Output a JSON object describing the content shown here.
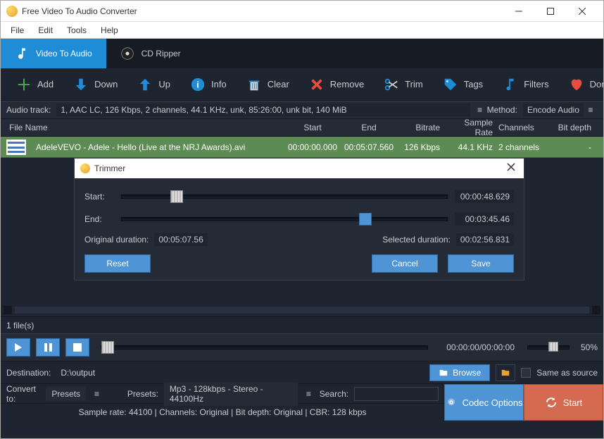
{
  "window": {
    "title": "Free Video To Audio Converter"
  },
  "menu": {
    "file": "File",
    "edit": "Edit",
    "tools": "Tools",
    "help": "Help"
  },
  "tabs": {
    "video_to_audio": "Video To Audio",
    "cd_ripper": "CD Ripper"
  },
  "toolbar": {
    "add": "Add",
    "down": "Down",
    "up": "Up",
    "info": "Info",
    "clear": "Clear",
    "remove": "Remove",
    "trim": "Trim",
    "tags": "Tags",
    "filters": "Filters",
    "donate": "Donate"
  },
  "audio_track": {
    "label": "Audio track:",
    "value": "1, AAC LC, 126 Kbps, 2 channels, 44.1 KHz, unk, 85:26:00, unk bit, 140 MiB",
    "method_label": "Method:",
    "method_value": "Encode Audio"
  },
  "columns": {
    "file_name": "File Name",
    "start": "Start",
    "end": "End",
    "bitrate": "Bitrate",
    "sample_rate": "Sample Rate",
    "channels": "Channels",
    "bit_depth": "Bit depth"
  },
  "file_row": {
    "name": "AdeleVEVO - Adele - Hello (Live at the NRJ Awards).avi",
    "start": "00:00:00.000",
    "end": "00:05:07.560",
    "bitrate": "126 Kbps",
    "sample_rate": "44.1 KHz",
    "channels": "2 channels",
    "bit_depth": "-"
  },
  "trimmer": {
    "title": "Trimmer",
    "start_label": "Start:",
    "start_value": "00:00:48.629",
    "end_label": "End:",
    "end_value": "00:03:45.46",
    "orig_label": "Original duration:",
    "orig_value": "00:05:07.56",
    "sel_label": "Selected duration:",
    "sel_value": "00:02:56.831",
    "reset": "Reset",
    "cancel": "Cancel",
    "save": "Save"
  },
  "file_count": "1 file(s)",
  "playbar": {
    "time": "00:00:00/00:00:00",
    "volume": "50%"
  },
  "destination": {
    "label": "Destination:",
    "value": "D:\\output",
    "browse": "Browse",
    "same_as_source": "Same as source"
  },
  "convert": {
    "label": "Convert to:",
    "presets_sel": "Presets",
    "presets_label": "Presets:",
    "preset_value": "Mp3 - 128kbps - Stereo - 44100Hz",
    "search_label": "Search:",
    "search_value": ""
  },
  "info_line": "Sample rate: 44100 | Channels: Original | Bit depth: Original | CBR: 128 kbps",
  "codec_options": "Codec Options",
  "start": "Start"
}
